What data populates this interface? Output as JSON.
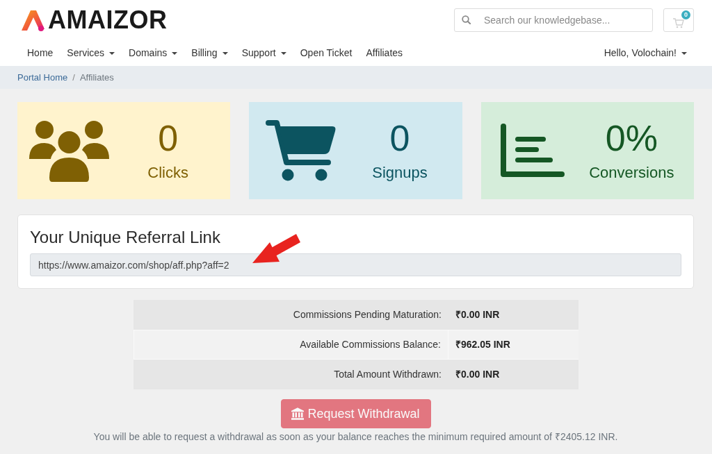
{
  "header": {
    "logo": "AMAIZOR",
    "search": {
      "placeholder": "Search our knowledgebase..."
    },
    "cart": {
      "count": "0"
    }
  },
  "nav": {
    "items": [
      {
        "label": "Home",
        "dropdown": false
      },
      {
        "label": "Services",
        "dropdown": true
      },
      {
        "label": "Domains",
        "dropdown": true
      },
      {
        "label": "Billing",
        "dropdown": true
      },
      {
        "label": "Support",
        "dropdown": true
      },
      {
        "label": "Open Ticket",
        "dropdown": false
      },
      {
        "label": "Affiliates",
        "dropdown": false
      }
    ],
    "user": {
      "label": "Hello, Volochain!",
      "dropdown": true
    }
  },
  "breadcrumb": {
    "separator": "/",
    "items": [
      {
        "label": "Portal Home",
        "link": true
      },
      {
        "label": "Affiliates",
        "link": false
      }
    ]
  },
  "stats": [
    {
      "kind": "users",
      "value": "0",
      "label": "Clicks",
      "color": "#7f6004"
    },
    {
      "kind": "cart",
      "value": "0",
      "label": "Signups",
      "color": "#0c5460"
    },
    {
      "kind": "chart",
      "value": "0%",
      "label": "Conversions",
      "color": "#155724"
    }
  ],
  "referral": {
    "title": "Your Unique Referral Link",
    "url": "https://www.amaizor.com/shop/aff.php?aff=2"
  },
  "balances": [
    {
      "label": "Commissions Pending Maturation:",
      "value": "₹0.00 INR"
    },
    {
      "label": "Available Commissions Balance:",
      "value": "₹962.05 INR"
    },
    {
      "label": "Total Amount Withdrawn:",
      "value": "₹0.00 INR"
    }
  ],
  "withdraw_button": {
    "label": "Request Withdrawal",
    "disabled": true
  },
  "note": "You will be able to request a withdrawal as soon as your balance reaches the minimum required amount of ₹2405.12 INR."
}
